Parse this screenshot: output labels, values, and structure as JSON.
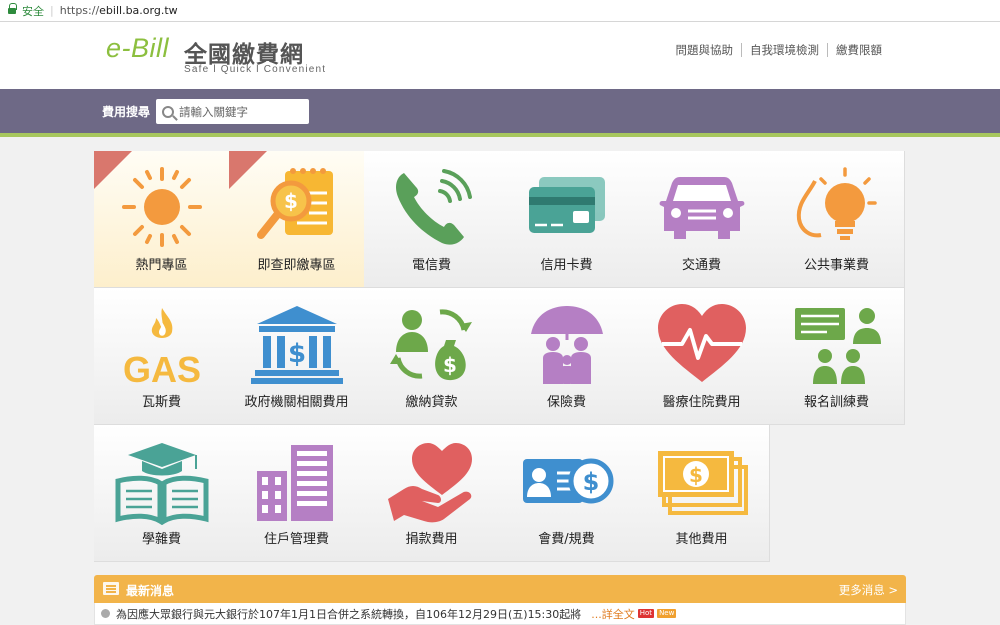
{
  "browser": {
    "secure_label": "安全",
    "url_scheme": "https://",
    "url_host": "ebill.ba.org.tw"
  },
  "header": {
    "logo_mark": "e-Bill",
    "logo_title": "全國繳費網",
    "logo_slogan": "Safe l Quick l Convenient",
    "links": [
      "問題與協助",
      "自我環境檢測",
      "繳費限額"
    ]
  },
  "search": {
    "label": "費用搜尋",
    "placeholder": "請輸入關鍵字"
  },
  "categories": [
    {
      "label": "熱門專區",
      "icon": "sun-icon",
      "featured": true
    },
    {
      "label": "即查即繳專區",
      "icon": "magnifier-bill-icon",
      "featured": true
    },
    {
      "label": "電信費",
      "icon": "phone-icon",
      "featured": false
    },
    {
      "label": "信用卡費",
      "icon": "credit-card-icon",
      "featured": false
    },
    {
      "label": "交通費",
      "icon": "car-icon",
      "featured": false
    },
    {
      "label": "公共事業費",
      "icon": "bulb-drop-icon",
      "featured": false
    },
    {
      "label": "瓦斯費",
      "icon": "gas-flame-icon",
      "featured": false
    },
    {
      "label": "政府機關相關費用",
      "icon": "government-building-icon",
      "featured": false
    },
    {
      "label": "繳納貸款",
      "icon": "loan-moneybag-icon",
      "featured": false
    },
    {
      "label": "保險費",
      "icon": "family-umbrella-icon",
      "featured": false
    },
    {
      "label": "醫療住院費用",
      "icon": "heart-pulse-icon",
      "featured": false
    },
    {
      "label": "報名訓練費",
      "icon": "presentation-people-icon",
      "featured": false
    },
    {
      "label": "學雜費",
      "icon": "graduation-book-icon",
      "featured": false
    },
    {
      "label": "住戶管理費",
      "icon": "apartment-icon",
      "featured": false
    },
    {
      "label": "捐款費用",
      "icon": "hand-heart-icon",
      "featured": false
    },
    {
      "label": "會費/規費",
      "icon": "id-card-dollar-icon",
      "featured": false
    },
    {
      "label": "其他費用",
      "icon": "banknotes-icon",
      "featured": false
    }
  ],
  "news": {
    "title": "最新消息",
    "more_label": "更多消息 >",
    "items": [
      {
        "text": "為因應大眾銀行與元大銀行於107年1月1日合併之系統轉換，自106年12月29日(五)15:30起將",
        "read_more": "...詳全文",
        "tags": [
          "Hot",
          "New"
        ]
      }
    ]
  },
  "colors": {
    "band": "#6e6986",
    "band_accent": "#a7c75d",
    "logo_green": "#8cbf3f",
    "ribbon": "#d9776d",
    "news_header": "#f2b44a"
  }
}
